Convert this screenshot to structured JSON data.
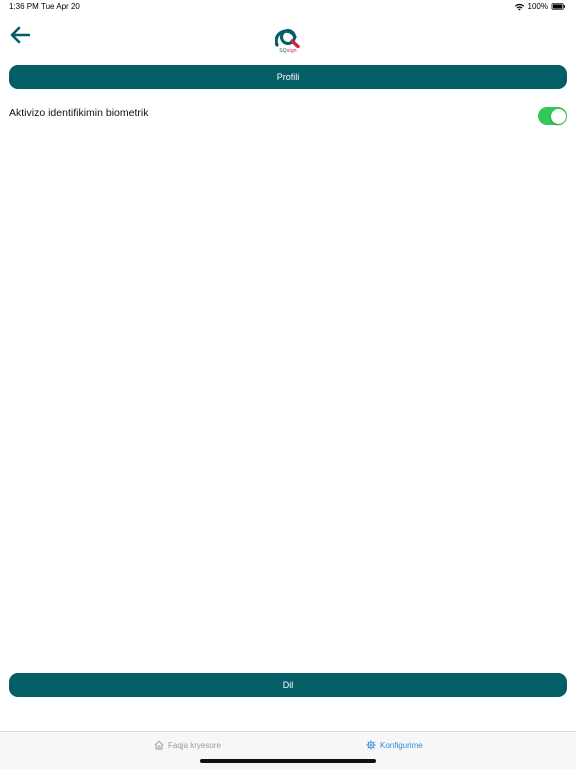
{
  "status_bar": {
    "time": "1:36 PM",
    "date": "Tue Apr 20",
    "battery": "100%"
  },
  "header": {
    "back_icon": "arrow-left-icon",
    "logo": {
      "prefix": "SQ",
      "suffix": "sign"
    }
  },
  "buttons": {
    "profile_label": "Profili",
    "language_label": "Dil"
  },
  "settings": {
    "biometric_label": "Aktivizo identifikimin biometrik",
    "biometric_enabled": true
  },
  "tabs": [
    {
      "label": "Faqja kryesore",
      "icon": "home-icon",
      "active": false
    },
    {
      "label": "Konfigurime",
      "icon": "gear-icon",
      "active": true
    }
  ],
  "colors": {
    "primary": "#035e66",
    "toggle_on": "#34c759",
    "tab_active": "#2f8bd8",
    "tab_inactive": "#9a9a9a",
    "logo_accent": "#d0253f"
  }
}
